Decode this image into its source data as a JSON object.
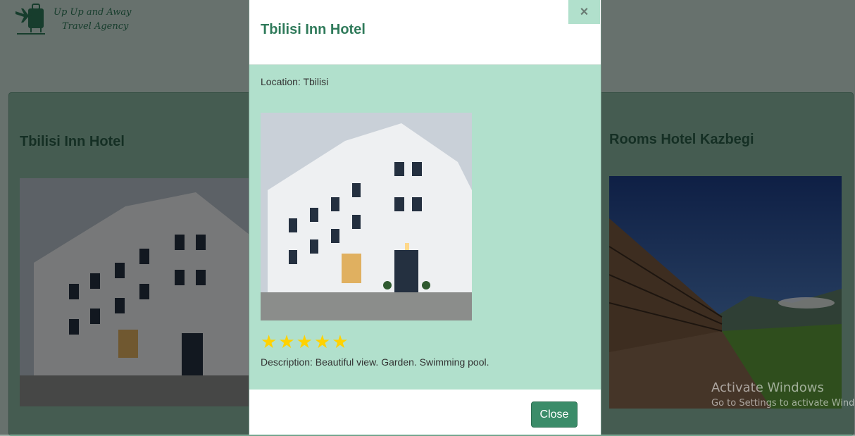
{
  "logo": {
    "line1": "Up Up and Away",
    "line2": "Travel Agency"
  },
  "cards": [
    {
      "title": "Tbilisi Inn Hotel"
    },
    {
      "title": "Rooms Hotel Kazbegi"
    }
  ],
  "modal": {
    "title": "Tbilisi Inn Hotel",
    "close_x": "×",
    "location": "Location: Tbilisi",
    "stars": 5,
    "star_glyph": "★",
    "description": "Description: Beautiful view. Garden. Swimming pool.",
    "close_label": "Close"
  },
  "watermark": {
    "line1": "Activate Windows",
    "line2": "Go to Settings to activate Windows."
  },
  "colors": {
    "accent": "#3b8c69",
    "body_bg": "#b1e0cc",
    "title": "#2f7a5a",
    "star": "#ffd200"
  }
}
